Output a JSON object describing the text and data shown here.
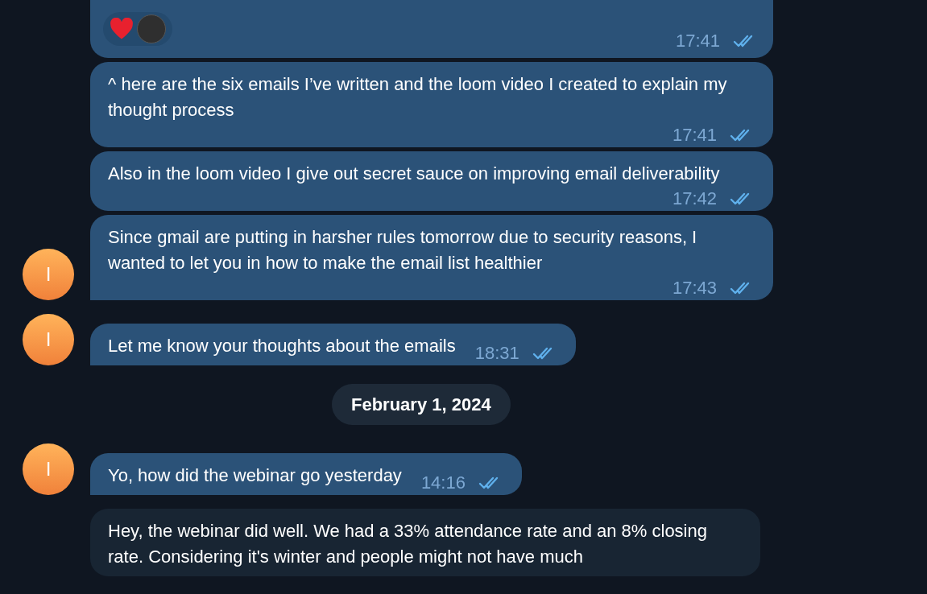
{
  "messages": [
    {
      "kind": "reactions",
      "outgoing": true,
      "show_avatar": false,
      "reactions": [
        {
          "kind": "heart"
        },
        {
          "kind": "avatar"
        }
      ],
      "time": "17:41",
      "read": true
    },
    {
      "kind": "text",
      "outgoing": true,
      "show_avatar": false,
      "text": "^ here are the six emails I’ve written and the loom video I created to explain my thought process",
      "time": "17:41",
      "read": true
    },
    {
      "kind": "text",
      "outgoing": true,
      "show_avatar": false,
      "text": "Also in the loom video I give out secret sauce on improving email deliverability",
      "time": "17:42",
      "read": true
    },
    {
      "kind": "text",
      "outgoing": true,
      "show_avatar": true,
      "avatar_letter": "I",
      "text": "Since gmail are putting in harsher rules tomorrow due to security reasons, I wanted to let you in how to make the email list healthier",
      "time": "17:43",
      "read": true
    },
    {
      "kind": "text",
      "outgoing": true,
      "show_avatar": true,
      "avatar_letter": "I",
      "text": "Let me know your thoughts about the emails",
      "time": "18:31",
      "read": true
    },
    {
      "kind": "date",
      "text": "February 1, 2024"
    },
    {
      "kind": "text",
      "outgoing": true,
      "show_avatar": true,
      "avatar_letter": "I",
      "text": "Yo, how did the webinar go yesterday",
      "time": "14:16",
      "read": true
    },
    {
      "kind": "text",
      "outgoing": false,
      "show_avatar": false,
      "text": "Hey, the webinar did well. We had a 33% attendance rate and an 8% closing rate. Considering it's winter and people might not have much"
    }
  ]
}
